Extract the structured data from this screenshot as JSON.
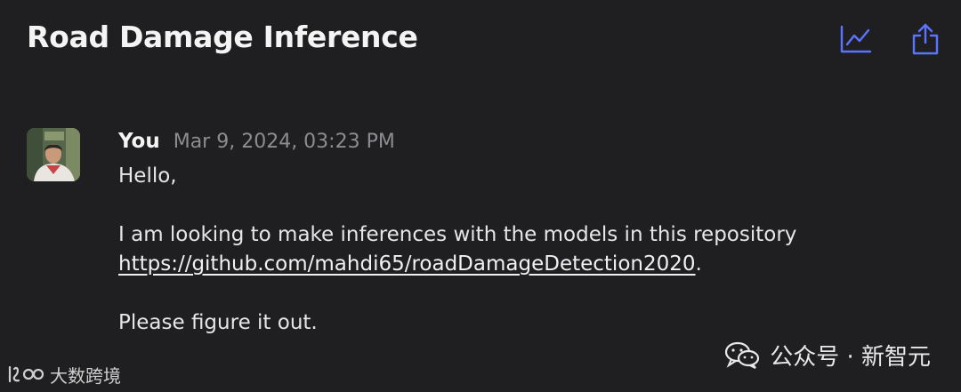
{
  "header": {
    "title": "Road Damage Inference",
    "actions": [
      {
        "icon": "chart-trend-icon"
      },
      {
        "icon": "share-icon"
      }
    ],
    "accent_color": "#5b74ff"
  },
  "message": {
    "author": "You",
    "timestamp": "Mar 9, 2024, 03:23 PM",
    "greeting": "Hello,",
    "body_text": "I am looking to make inferences with the models in this repository",
    "link": "https://github.com/mahdi65/roadDamageDetection2020",
    "link_suffix": ".",
    "closing": "Please figure it out."
  },
  "watermarks": {
    "left_text": "大数跨境",
    "right_text": "公众号 · 新智元"
  }
}
